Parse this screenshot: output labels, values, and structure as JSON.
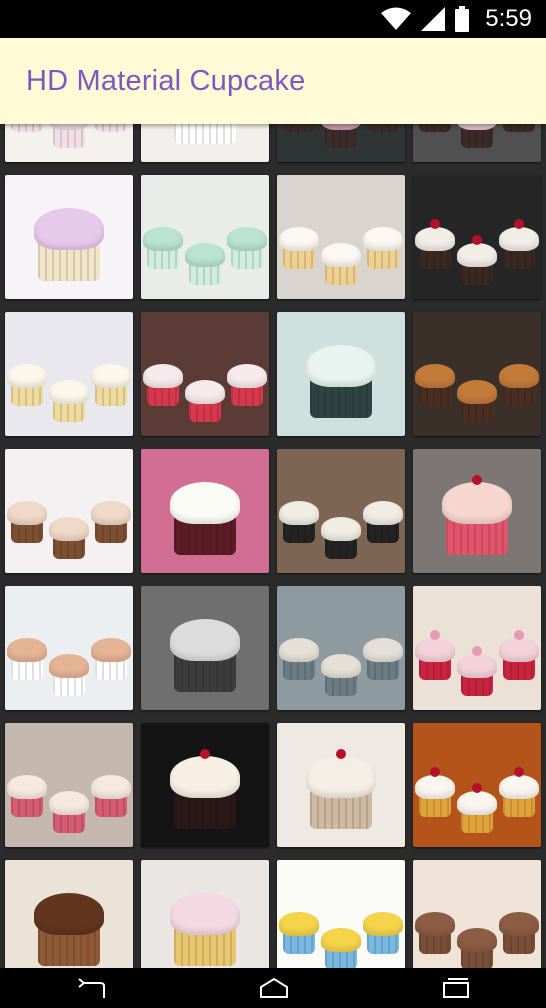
{
  "status_bar": {
    "time": "5:59",
    "icons": [
      "wifi-icon",
      "signal-icon",
      "battery-icon"
    ]
  },
  "app_bar": {
    "title": "HD Material Cupcake",
    "background": "#fffbd6",
    "title_color": "#7e57c2"
  },
  "gallery": {
    "thumbnails": [
      {
        "bg": "#f3f0ee",
        "frost": "#f8e6ee",
        "liner": "#f2dfe6",
        "style": "sprinkle-white"
      },
      {
        "bg": "#f1efeb",
        "frost": "#5a3324",
        "liner": "#ffffff",
        "style": "plate"
      },
      {
        "bg": "#2f3534",
        "frost": "#d9a6b8",
        "liner": "#3a2c2a",
        "style": "dark"
      },
      {
        "bg": "#505050",
        "frost": "#f0d0de",
        "liner": "#3b2a28",
        "style": "dark"
      },
      {
        "bg": "#f6f4f6",
        "frost": "#e7c9ec",
        "liner": "#f2e4c8",
        "style": "rainbow"
      },
      {
        "bg": "#e9ece8",
        "frost": "#b9e3d2",
        "liner": "#cfeee1",
        "style": "pastel-row"
      },
      {
        "bg": "#d9d4ce",
        "frost": "#fbf7f1",
        "liner": "#f0cf90",
        "style": "vanilla"
      },
      {
        "bg": "#262626",
        "frost": "#f2ede6",
        "liner": "#3a2823",
        "style": "blackforest"
      },
      {
        "bg": "#e9e8ee",
        "frost": "#fbf7ea",
        "liner": "#efdc9d",
        "style": "vanilla"
      },
      {
        "bg": "#5a3b35",
        "frost": "#f7eaec",
        "liner": "#d8384b",
        "style": "tiers"
      },
      {
        "bg": "#cfe1de",
        "frost": "#e9f3f0",
        "liner": "#2f4442",
        "style": "teal"
      },
      {
        "bg": "#3b2f2a",
        "frost": "#c47b3a",
        "liner": "#4a2e23",
        "style": "choco"
      },
      {
        "bg": "#f5f0f2",
        "frost": "#efd9c8",
        "liner": "#7d4f32",
        "style": "macaron"
      },
      {
        "bg": "#d26d93",
        "frost": "#fbfbf6",
        "liner": "#5c1c26",
        "style": "big-dome"
      },
      {
        "bg": "#7c6553",
        "frost": "#f1ece4",
        "liner": "#232323",
        "style": "stand"
      },
      {
        "bg": "#7c7775",
        "frost": "#f6d6cf",
        "liner": "#e2546c",
        "style": "polka"
      },
      {
        "bg": "#eceff2",
        "frost": "#e5b495",
        "liner": "#ffffff",
        "style": "meringue"
      },
      {
        "bg": "#6f6f6f",
        "frost": "#dcdcdc",
        "liner": "#3c3c3c",
        "style": "bw-child"
      },
      {
        "bg": "#8d9aa0",
        "frost": "#e5e0d7",
        "liner": "#6c7c84",
        "style": "grey-small"
      },
      {
        "bg": "#ebe1d6",
        "frost": "#f4d2da",
        "liner": "#c8233f",
        "style": "hearts"
      },
      {
        "bg": "#c5b7ad",
        "frost": "#f6e9e0",
        "liner": "#d65c73",
        "style": "boxes"
      },
      {
        "bg": "#141414",
        "frost": "#f7efe4",
        "liner": "#2a1816",
        "style": "single-dark"
      },
      {
        "bg": "#efe9e4",
        "frost": "#f4eee6",
        "liner": "#cfb9a2",
        "style": "jar"
      },
      {
        "bg": "#b5541a",
        "frost": "#fbf5ef",
        "liner": "#e0a33a",
        "style": "cherry-stand"
      },
      {
        "bg": "#ebe2d8",
        "frost": "#62351f",
        "liner": "#8f5a35",
        "style": "cup-choc"
      },
      {
        "bg": "#eae6e3",
        "frost": "#f4d8e2",
        "liner": "#e8c770",
        "style": "unicorn"
      },
      {
        "bg": "#fbfbf8",
        "frost": "#f5d44a",
        "liner": "#79b8e0",
        "style": "colorful"
      },
      {
        "bg": "#efe3d8",
        "frost": "#8c5d44",
        "liner": "#7a4e38",
        "style": "choc-many"
      }
    ]
  }
}
